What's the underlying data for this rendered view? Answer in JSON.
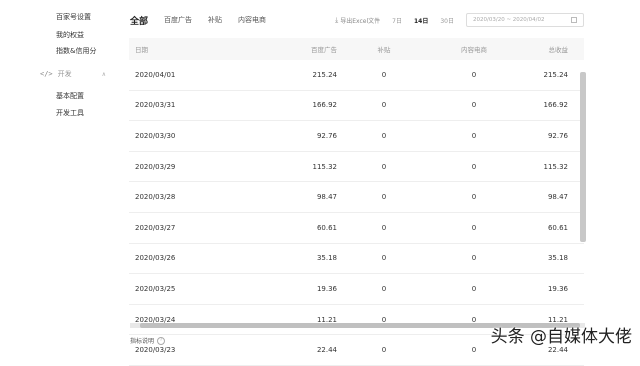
{
  "sidebar": {
    "items_top": [
      "百家号设置",
      "我的权益",
      "指数&信用分"
    ],
    "section_label": "开发",
    "section_items": [
      "基本配置",
      "开发工具"
    ]
  },
  "tabs": [
    "全部",
    "百度广告",
    "补贴",
    "内容电商"
  ],
  "toolbar": {
    "export_label": "导出Excel文件",
    "ranges": [
      "7日",
      "14日",
      "30日"
    ],
    "date_range": "2020/03/20 ~ 2020/04/02"
  },
  "table": {
    "columns": [
      "日期",
      "百度广告",
      "补贴",
      "内容电商",
      "总收益"
    ],
    "rows": [
      [
        "2020/04/01",
        "215.24",
        "0",
        "0",
        "215.24"
      ],
      [
        "2020/03/31",
        "166.92",
        "0",
        "0",
        "166.92"
      ],
      [
        "2020/03/30",
        "92.76",
        "0",
        "0",
        "92.76"
      ],
      [
        "2020/03/29",
        "115.32",
        "0",
        "0",
        "115.32"
      ],
      [
        "2020/03/28",
        "98.47",
        "0",
        "0",
        "98.47"
      ],
      [
        "2020/03/27",
        "60.61",
        "0",
        "0",
        "60.61"
      ],
      [
        "2020/03/26",
        "35.18",
        "0",
        "0",
        "35.18"
      ],
      [
        "2020/03/25",
        "19.36",
        "0",
        "0",
        "19.36"
      ],
      [
        "2020/03/24",
        "11.21",
        "0",
        "0",
        "11.21"
      ],
      [
        "2020/03/23",
        "22.44",
        "0",
        "0",
        "22.44"
      ]
    ]
  },
  "footer": {
    "label": "指标说明"
  },
  "watermark": "头条 @自媒体大佬"
}
